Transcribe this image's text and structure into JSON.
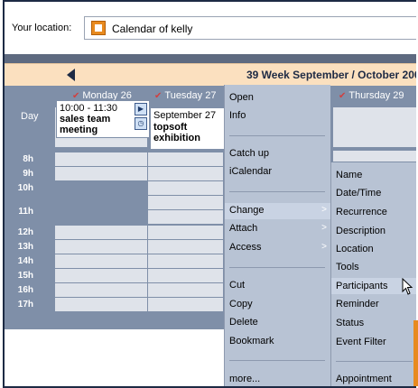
{
  "location": {
    "label": "Your location:",
    "value": "Calendar of kelly",
    "icon": "calendar-icon"
  },
  "week": {
    "prefix": "39 Week",
    "range": "September / October 200",
    "nav_icon": "previous-arrow-icon"
  },
  "days": [
    "Monday 26",
    "Tuesday 27",
    "Thursday 29"
  ],
  "day_row_label": "Day",
  "hours": [
    "8h",
    "9h",
    "10h",
    "11h",
    "12h",
    "13h",
    "14h",
    "15h",
    "16h",
    "17h"
  ],
  "allday_event": {
    "date": "September 27",
    "title_line1": "topsoft",
    "title_line2": "exhibition"
  },
  "event": {
    "time": "10:00 - 11:30",
    "title_line1": "sales team",
    "title_line2": "meeting",
    "icons": [
      "play-icon",
      "clock-icon"
    ]
  },
  "context_menu": {
    "items": [
      {
        "label": "Open"
      },
      {
        "label": "Info"
      },
      {
        "label": "Catch up"
      },
      {
        "label": "iCalendar"
      },
      {
        "label": "Change",
        "has_submenu": true
      },
      {
        "label": "Attach",
        "has_submenu": true
      },
      {
        "label": "Access",
        "has_submenu": true
      },
      {
        "label": "Cut"
      },
      {
        "label": "Copy"
      },
      {
        "label": "Delete"
      },
      {
        "label": "Bookmark"
      },
      {
        "label": "more..."
      }
    ]
  },
  "submenu": {
    "items": [
      {
        "label": "Name"
      },
      {
        "label": "Date/Time"
      },
      {
        "label": "Recurrence"
      },
      {
        "label": "Description"
      },
      {
        "label": "Location"
      },
      {
        "label": "Tools"
      },
      {
        "label": "Participants"
      },
      {
        "label": "Reminder"
      },
      {
        "label": "Status"
      },
      {
        "label": "Event Filter"
      },
      {
        "label": "Appointment"
      }
    ]
  },
  "colors": {
    "frame": "#1d2a44",
    "grid_header": "#7f8fa8",
    "cell": "#dfe3ea",
    "menu": "#b8c3d4",
    "week_bar": "#fbe0bf",
    "accent": "#e88a1f"
  }
}
